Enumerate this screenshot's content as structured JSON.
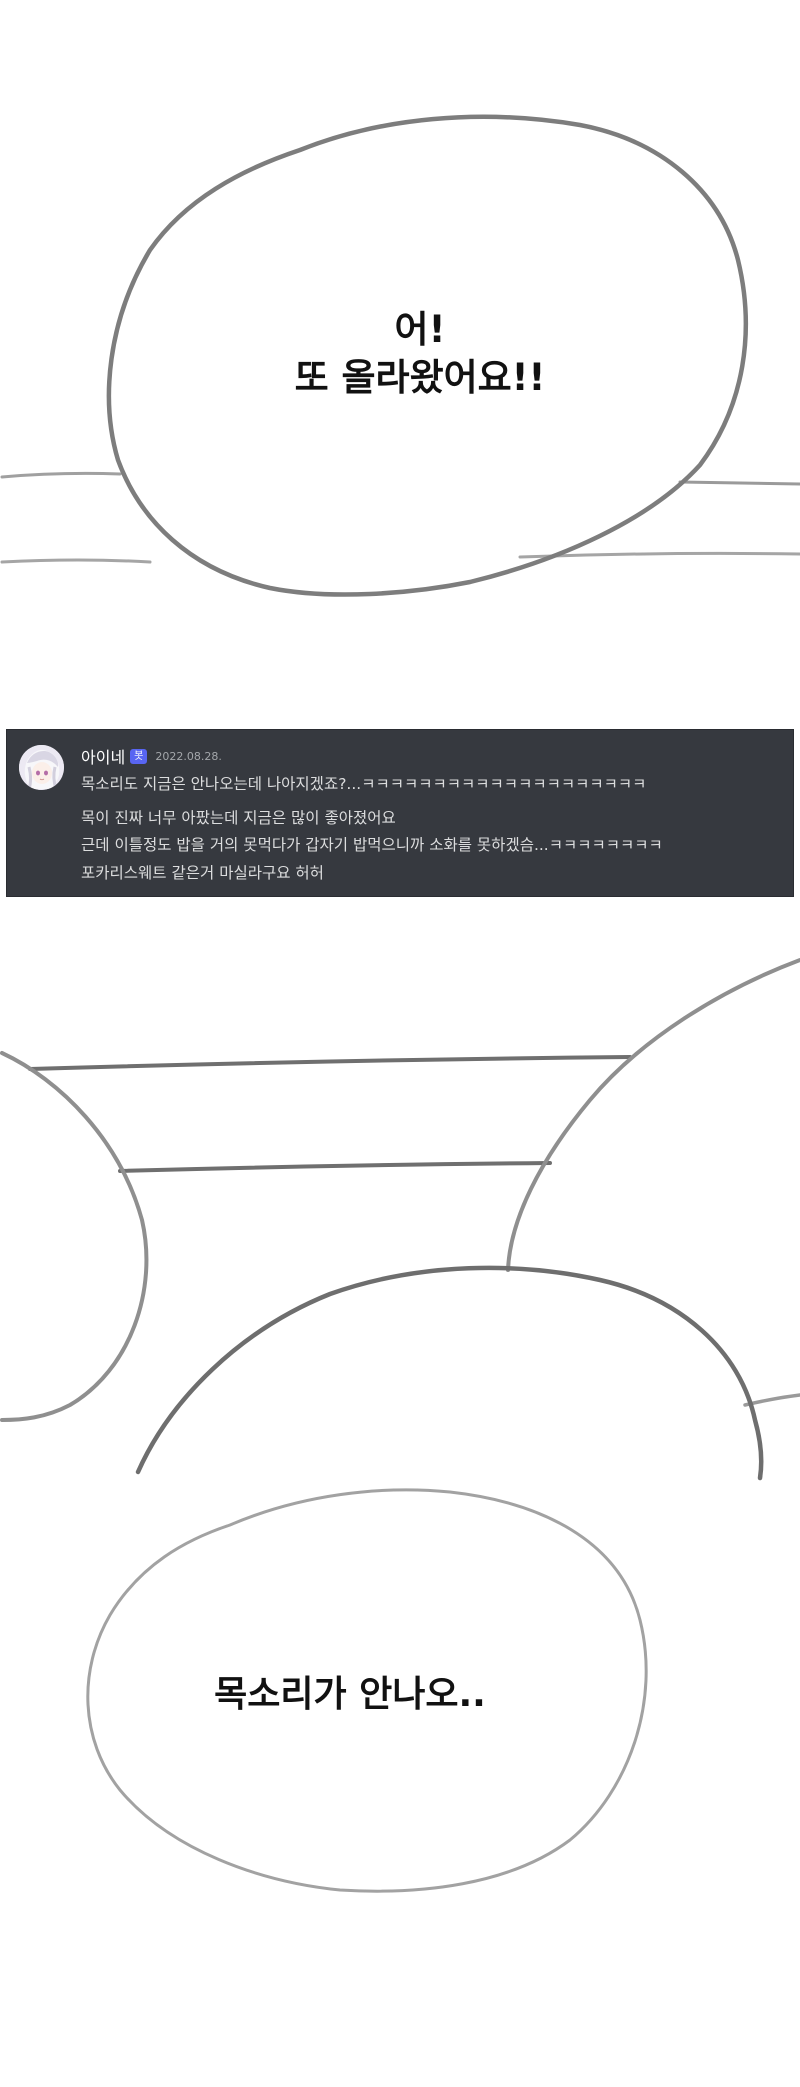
{
  "panels": [
    {
      "speech": [
        "어!",
        "또 올라왔어요!!"
      ]
    },
    {
      "speech": [
        "목소리가 안나오.."
      ]
    }
  ],
  "chat": {
    "username": "아이네",
    "badge": "봇",
    "timestamp": "2022.08.28.",
    "messages": [
      "목소리도 지금은 안나오는데 나아지겠죠?...ㅋㅋㅋㅋㅋㅋㅋㅋㅋㅋㅋㅋㅋㅋㅋㅋㅋㅋㅋㅋ",
      "목이 진짜 너무 아팠는데 지금은 많이 좋아졌어요",
      "근데 이틀정도 밥을 거의 못먹다가 갑자기 밥먹으니까 소화를 못하겠슴...ㅋㅋㅋㅋㅋㅋㅋㅋ",
      "포카리스웨트 같은거 마실라구요 허허"
    ],
    "colors": {
      "background": "#36393f",
      "username": "#ffffff",
      "text": "#dcddde",
      "timestamp": "#a3a6aa",
      "badge": "#5865f2"
    }
  },
  "sketch": {
    "line_color": "#8a8a8a"
  }
}
